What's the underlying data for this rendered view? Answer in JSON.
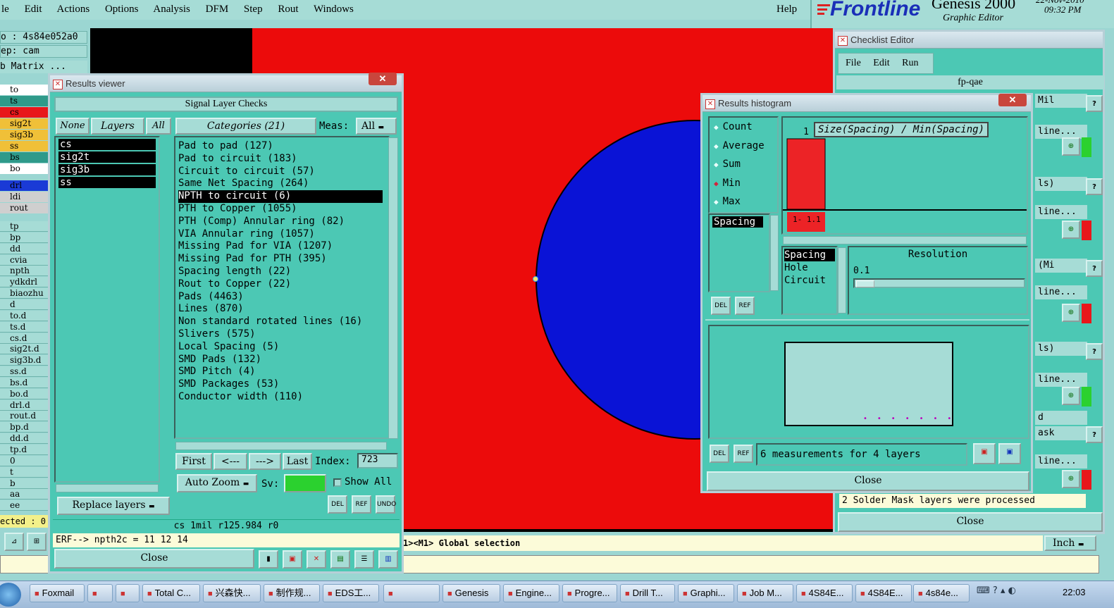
{
  "menu": [
    "le",
    "Edit",
    "Actions",
    "Options",
    "Analysis",
    "DFM",
    "Step",
    "Rout",
    "Windows"
  ],
  "help": "Help",
  "brand": {
    "name": "Frontline",
    "product": "Genesis 2000",
    "sub": "Graphic Editor",
    "date": "22-Nov-2010",
    "time": "09:32 PM"
  },
  "left_panel": {
    "job": "o : 4s84e052a0",
    "step": "ep: cam",
    "matrix": "b Matrix ...",
    "layers1": [
      {
        "name": "to",
        "color": "#ffffff"
      },
      {
        "name": "ts",
        "color": "#2f9a8a"
      },
      {
        "name": "cs",
        "color": "#e8171b"
      },
      {
        "name": "sig2t",
        "color": "#f0c038"
      },
      {
        "name": "sig3b",
        "color": "#f0c038"
      },
      {
        "name": "ss",
        "color": "#f0c038"
      },
      {
        "name": "bs",
        "color": "#2f9a8a"
      },
      {
        "name": "bo",
        "color": "#ffffff"
      }
    ],
    "layers2": [
      {
        "name": "drl",
        "color": "#1a3ad6"
      },
      {
        "name": "ldi",
        "color": "#cfcfcf"
      },
      {
        "name": "rout",
        "color": "#cfcfcf"
      }
    ],
    "layers3": [
      "tp",
      "bp",
      "dd",
      "cvia",
      "npth",
      "ydkdrl",
      "biaozhu",
      "d",
      "to.d",
      "ts.d",
      "cs.d",
      "sig2t.d",
      "sig3b.d",
      "ss.d",
      "bs.d",
      "bo.d",
      "drl.d",
      "rout.d",
      "bp.d",
      "dd.d",
      "tp.d",
      "0",
      "t",
      "b",
      "aa",
      "ee"
    ],
    "selected": "ected : 0"
  },
  "results_viewer": {
    "title": "Results viewer",
    "header": "Signal Layer Checks",
    "none_btn": "None",
    "layers_btn": "Layers",
    "all_btn": "All",
    "categories_btn": "Categories (21)",
    "meas_label": "Meas:",
    "meas_value": "All",
    "layers": [
      "cs",
      "sig2t",
      "sig3b",
      "ss"
    ],
    "categories": [
      "Pad to pad (127)",
      "Pad to circuit (183)",
      "Circuit to circuit (57)",
      "Same Net Spacing (264)",
      "NPTH to circuit (6)",
      "PTH to Copper (1055)",
      "PTH (Comp) Annular ring (82)",
      "VIA Annular ring (1057)",
      "Missing Pad for VIA (1207)",
      "Missing Pad for PTH (395)",
      "Spacing length (22)",
      "Rout to Copper (22)",
      "Pads (4463)",
      "Lines (870)",
      "Non standard rotated lines (16)",
      "Slivers (575)",
      "Local Spacing (5)",
      "SMD Pads (132)",
      "SMD Pitch (4)",
      "SMD Packages (53)",
      "Conductor width (110)"
    ],
    "selected_category": 4,
    "first": "First",
    "prev": "<---",
    "next": "--->",
    "last": "Last",
    "index_label": "Index:",
    "index_value": "723",
    "auto_zoom": "Auto Zoom",
    "sv_label": "Sv:",
    "show_all": "Show All",
    "replace_layers": "Replace layers",
    "status": "cs  1mil  r125.984  r0",
    "erf": "ERF--> npth2c = 11 12 14",
    "close": "Close",
    "del": "DEL",
    "ref": "REF",
    "undo": "UNDO"
  },
  "histogram": {
    "title": "Results histogram",
    "modes": [
      "Count",
      "Average",
      "Sum",
      "Min",
      "Max"
    ],
    "selected_mode": 3,
    "chart_title": "Size(Spacing) / Min(Spacing)",
    "measure_list": [
      "Spacing"
    ],
    "bar_value": "1",
    "bar_label": "1- 1.1",
    "attr_list": [
      "Spacing",
      "Hole",
      "Circuit"
    ],
    "resolution_label": "Resolution",
    "resolution_value": "0.1",
    "summary": "6 measurements for 4 layers",
    "close": "Close",
    "del": "DEL",
    "ref": "REF"
  },
  "chart_data": {
    "type": "bar",
    "title": "Size(Spacing) / Min(Spacing)",
    "categories": [
      "1- 1.1"
    ],
    "values": [
      1
    ],
    "xlabel": "",
    "ylabel": ""
  },
  "checklist": {
    "title": "Checklist Editor",
    "menu": [
      "File",
      "Edit",
      "Run"
    ],
    "name": "fp-qae",
    "items": [
      "Mil",
      "line...",
      "ls)",
      "line...",
      "(Mi",
      "line...",
      "ls)",
      "line...",
      "d",
      "ask",
      "line..."
    ],
    "message": "2 Solder Mask layers were processed",
    "close": "Close"
  },
  "bottom": {
    "message": "1><M1> Global selection",
    "units": "Inch"
  },
  "taskbar": {
    "items": [
      "Foxmail",
      "",
      "",
      "Total C...",
      "兴森快...",
      "制作规...",
      "EDS工...",
      "",
      "Genesis",
      "Engine...",
      "Progre...",
      "Drill T...",
      "Graphi...",
      "Job M...",
      "4S84E...",
      "4S84E...",
      "4s84e..."
    ],
    "clock": "22:03"
  },
  "colors": {
    "workspace": "#ec0b0b",
    "pad": "#0a13d6",
    "teal": "#4cc8b4",
    "pale": "#a6dcd6"
  }
}
